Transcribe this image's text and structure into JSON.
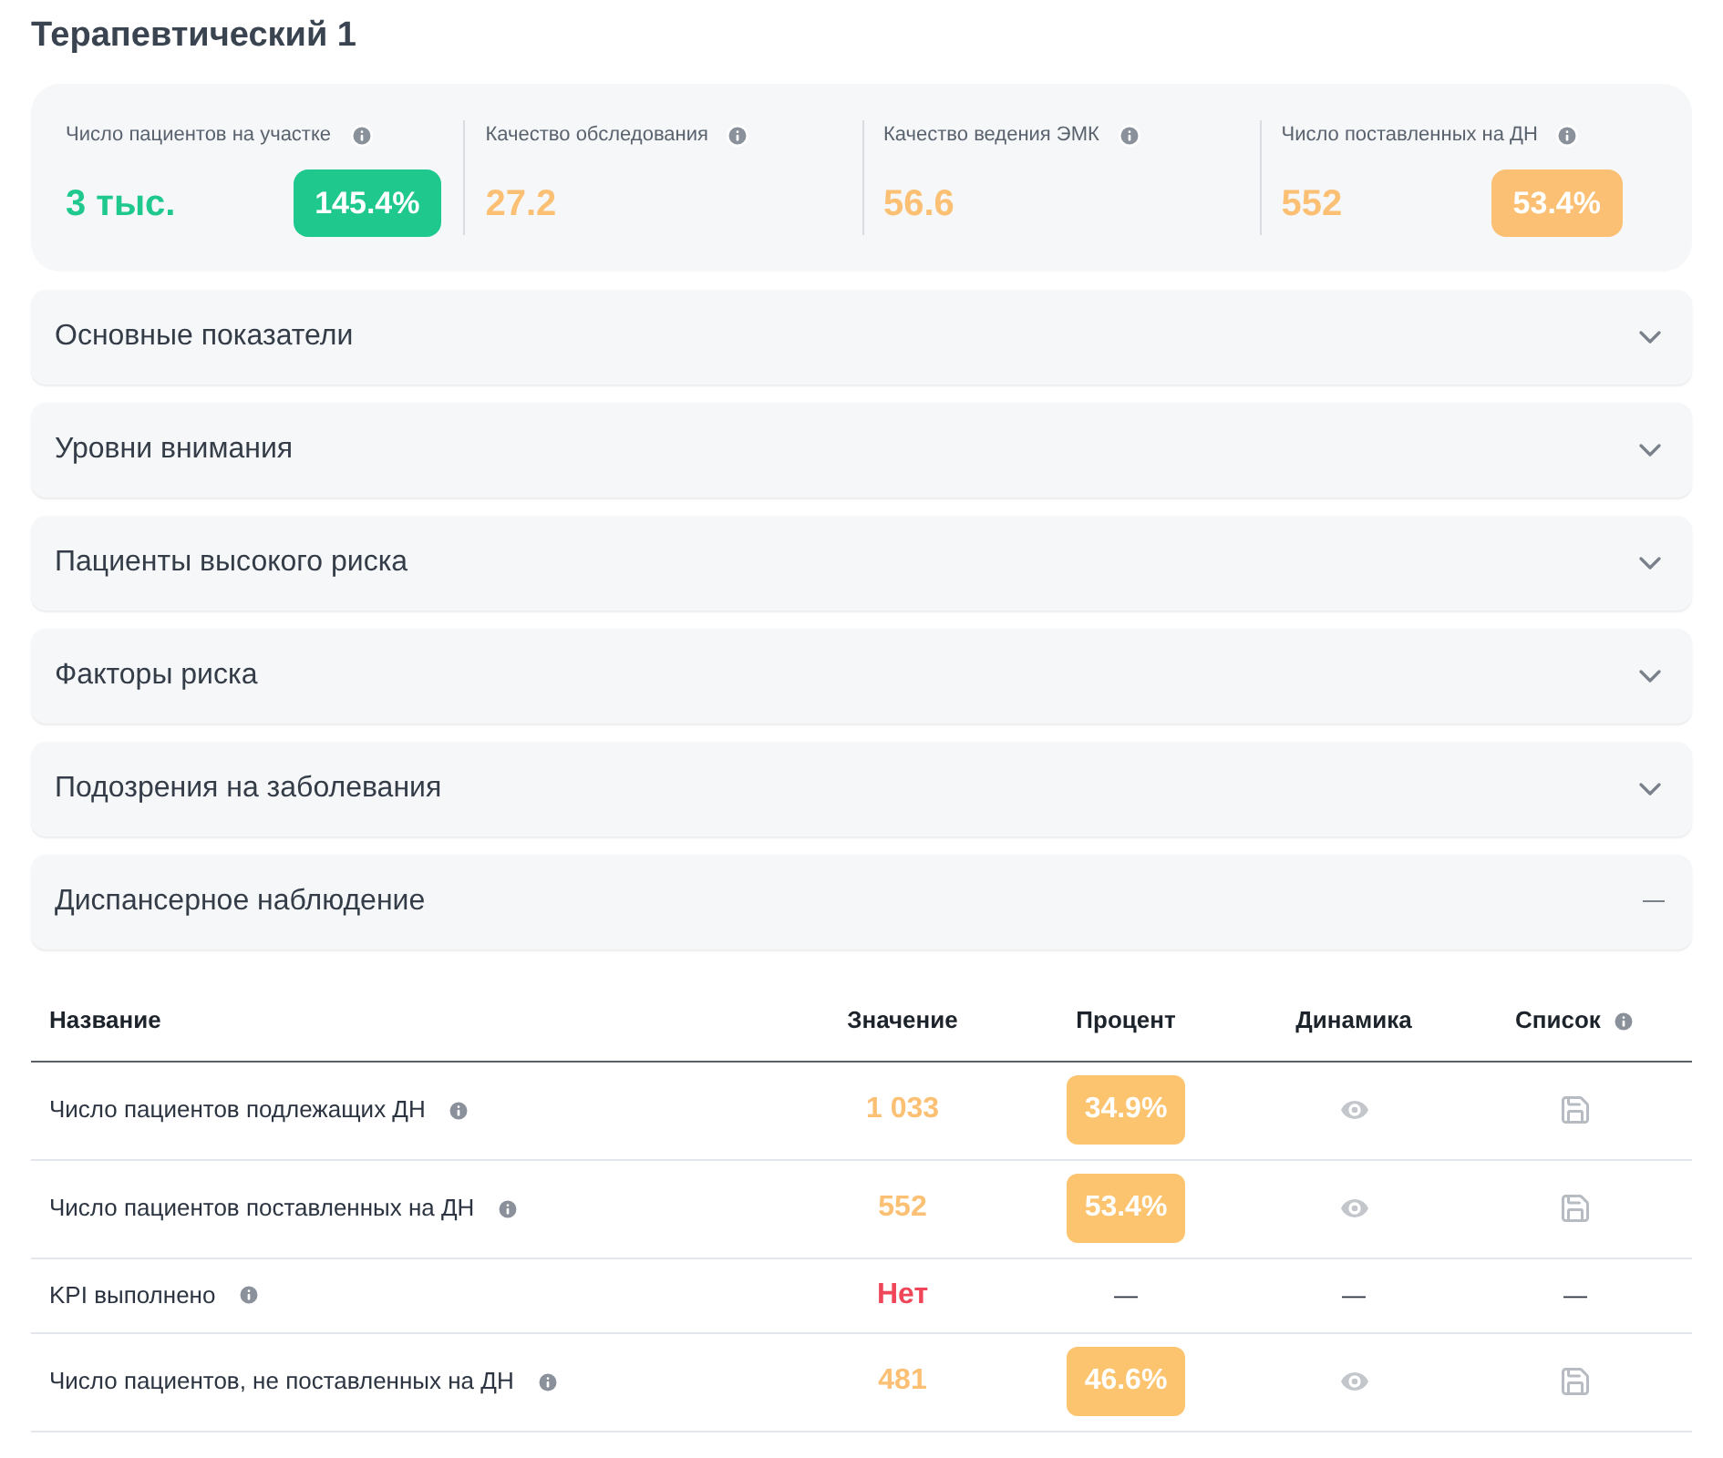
{
  "title": "Терапевтический 1",
  "summary": [
    {
      "label": "Число пациентов на участке",
      "value": "3 тыс.",
      "color": "#1fc98e",
      "badge": "145.4%"
    },
    {
      "label": "Качество обследования",
      "value": "27.2",
      "color": "#fbc074"
    },
    {
      "label": "Качество ведения ЭМК",
      "value": "56.6",
      "color": "#fbc074"
    },
    {
      "label": "Число поставленных на ДН",
      "value": "552",
      "color": "#fbc074",
      "badge": "53.4%"
    }
  ],
  "sections": [
    {
      "title": "Основные показатели",
      "expanded": false
    },
    {
      "title": "Уровни внимания",
      "expanded": false
    },
    {
      "title": "Пациенты высокого риска",
      "expanded": false
    },
    {
      "title": "Факторы риска",
      "expanded": false
    },
    {
      "title": "Подозрения на заболевания",
      "expanded": false
    },
    {
      "title": "Диспансерное наблюдение",
      "expanded": true
    }
  ],
  "table": {
    "columns": [
      "Название",
      "Значение",
      "Процент",
      "Динамика",
      "Список"
    ],
    "rows": [
      {
        "kind": "data",
        "name": "Число пациентов подлежащих ДН",
        "value": "1 033",
        "color": "#fbc074",
        "percent": "34.9%"
      },
      {
        "kind": "data",
        "name": "Число пациентов поставленных на ДН",
        "value": "552",
        "color": "#fbc074",
        "percent": "53.4%"
      },
      {
        "kind": "flag",
        "name": "KPI выполнено",
        "value": "Нет",
        "color": "#f0465a",
        "percent": "—",
        "dynamics": "—",
        "list": "—"
      },
      {
        "kind": "data",
        "name": "Число пациентов, не поставленных на ДН",
        "value": "481",
        "color": "#fbc074",
        "percent": "46.6%"
      }
    ]
  }
}
